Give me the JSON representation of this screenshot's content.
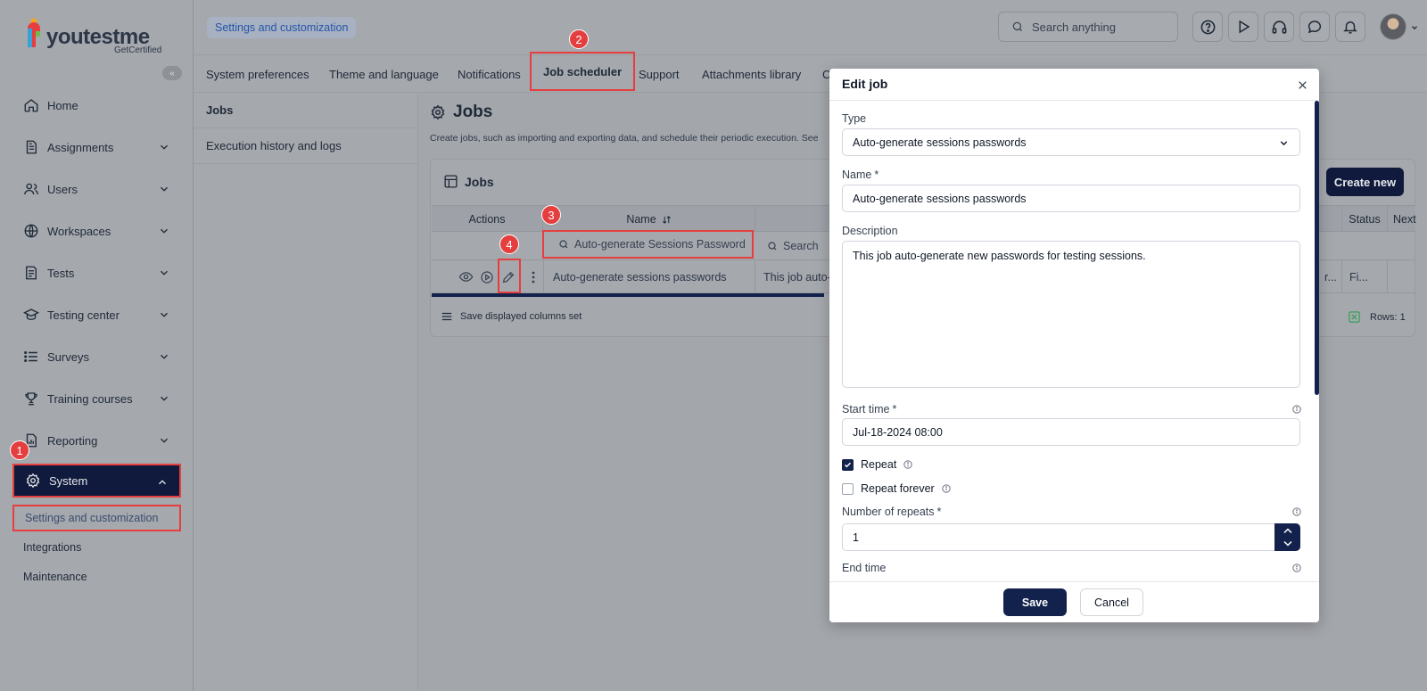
{
  "app": {
    "logo_text": "youtestme",
    "logo_sub": "GetCertified"
  },
  "colors": {
    "navy": "#0f1a3c",
    "highlight_red": "#e53e3e",
    "breadcrumb_blue": "#2356a8"
  },
  "sidebar": {
    "collapse_glyph": "«",
    "items": [
      {
        "label": "Home",
        "icon": "home-icon"
      },
      {
        "label": "Assignments",
        "icon": "document-icon"
      },
      {
        "label": "Users",
        "icon": "users-icon"
      },
      {
        "label": "Workspaces",
        "icon": "globe-icon"
      },
      {
        "label": "Tests",
        "icon": "test-icon"
      },
      {
        "label": "Testing center",
        "icon": "graduation-cap-icon"
      },
      {
        "label": "Surveys",
        "icon": "list-icon"
      },
      {
        "label": "Training courses",
        "icon": "trophy-icon"
      },
      {
        "label": "Reporting",
        "icon": "report-icon"
      },
      {
        "label": "System",
        "icon": "gear-icon"
      }
    ],
    "subitems": [
      {
        "label": "Settings and customization"
      },
      {
        "label": "Integrations"
      },
      {
        "label": "Maintenance"
      }
    ]
  },
  "header": {
    "breadcrumb": "Settings and customization",
    "search_placeholder": "Search anything"
  },
  "tabs": [
    {
      "label": "System preferences"
    },
    {
      "label": "Theme and language"
    },
    {
      "label": "Notifications"
    },
    {
      "label": "Job scheduler"
    },
    {
      "label": "Support"
    },
    {
      "label": "Attachments library"
    },
    {
      "label": "C"
    }
  ],
  "subnav": [
    {
      "label": "Jobs"
    },
    {
      "label": "Execution history and logs"
    }
  ],
  "main": {
    "title": "Jobs",
    "description": "Create jobs, such as importing and exporting data, and schedule their periodic execution. See"
  },
  "card": {
    "title": "Jobs",
    "create_label": "Create new",
    "columns": {
      "actions": "Actions",
      "name": "Name",
      "status": "Status",
      "next": "Next"
    },
    "name_filter": "Auto-generate Sessions Password",
    "search_placeholder": "Search",
    "row": {
      "name": "Auto-generate sessions passwords",
      "description": "This job auto-",
      "truncated": "r...",
      "status": "Fi..."
    },
    "footer_label": "Save displayed columns set",
    "rows_label": "Rows: 1"
  },
  "steps": [
    "1",
    "2",
    "3",
    "4"
  ],
  "modal": {
    "title": "Edit job",
    "type_label": "Type",
    "type_value": "Auto-generate sessions passwords",
    "name_label": "Name",
    "name_value": "Auto-generate sessions passwords",
    "description_label": "Description",
    "description_value": "This job auto-generate new passwords for testing sessions.",
    "start_time_label": "Start time",
    "start_time_value": "Jul-18-2024 08:00",
    "repeat_label": "Repeat",
    "repeat_checked": true,
    "repeat_forever_label": "Repeat forever",
    "repeat_forever_checked": false,
    "repeats_label": "Number of repeats",
    "repeats_value": "1",
    "end_time_label": "End time",
    "required_mark": "*",
    "save_label": "Save",
    "cancel_label": "Cancel"
  }
}
